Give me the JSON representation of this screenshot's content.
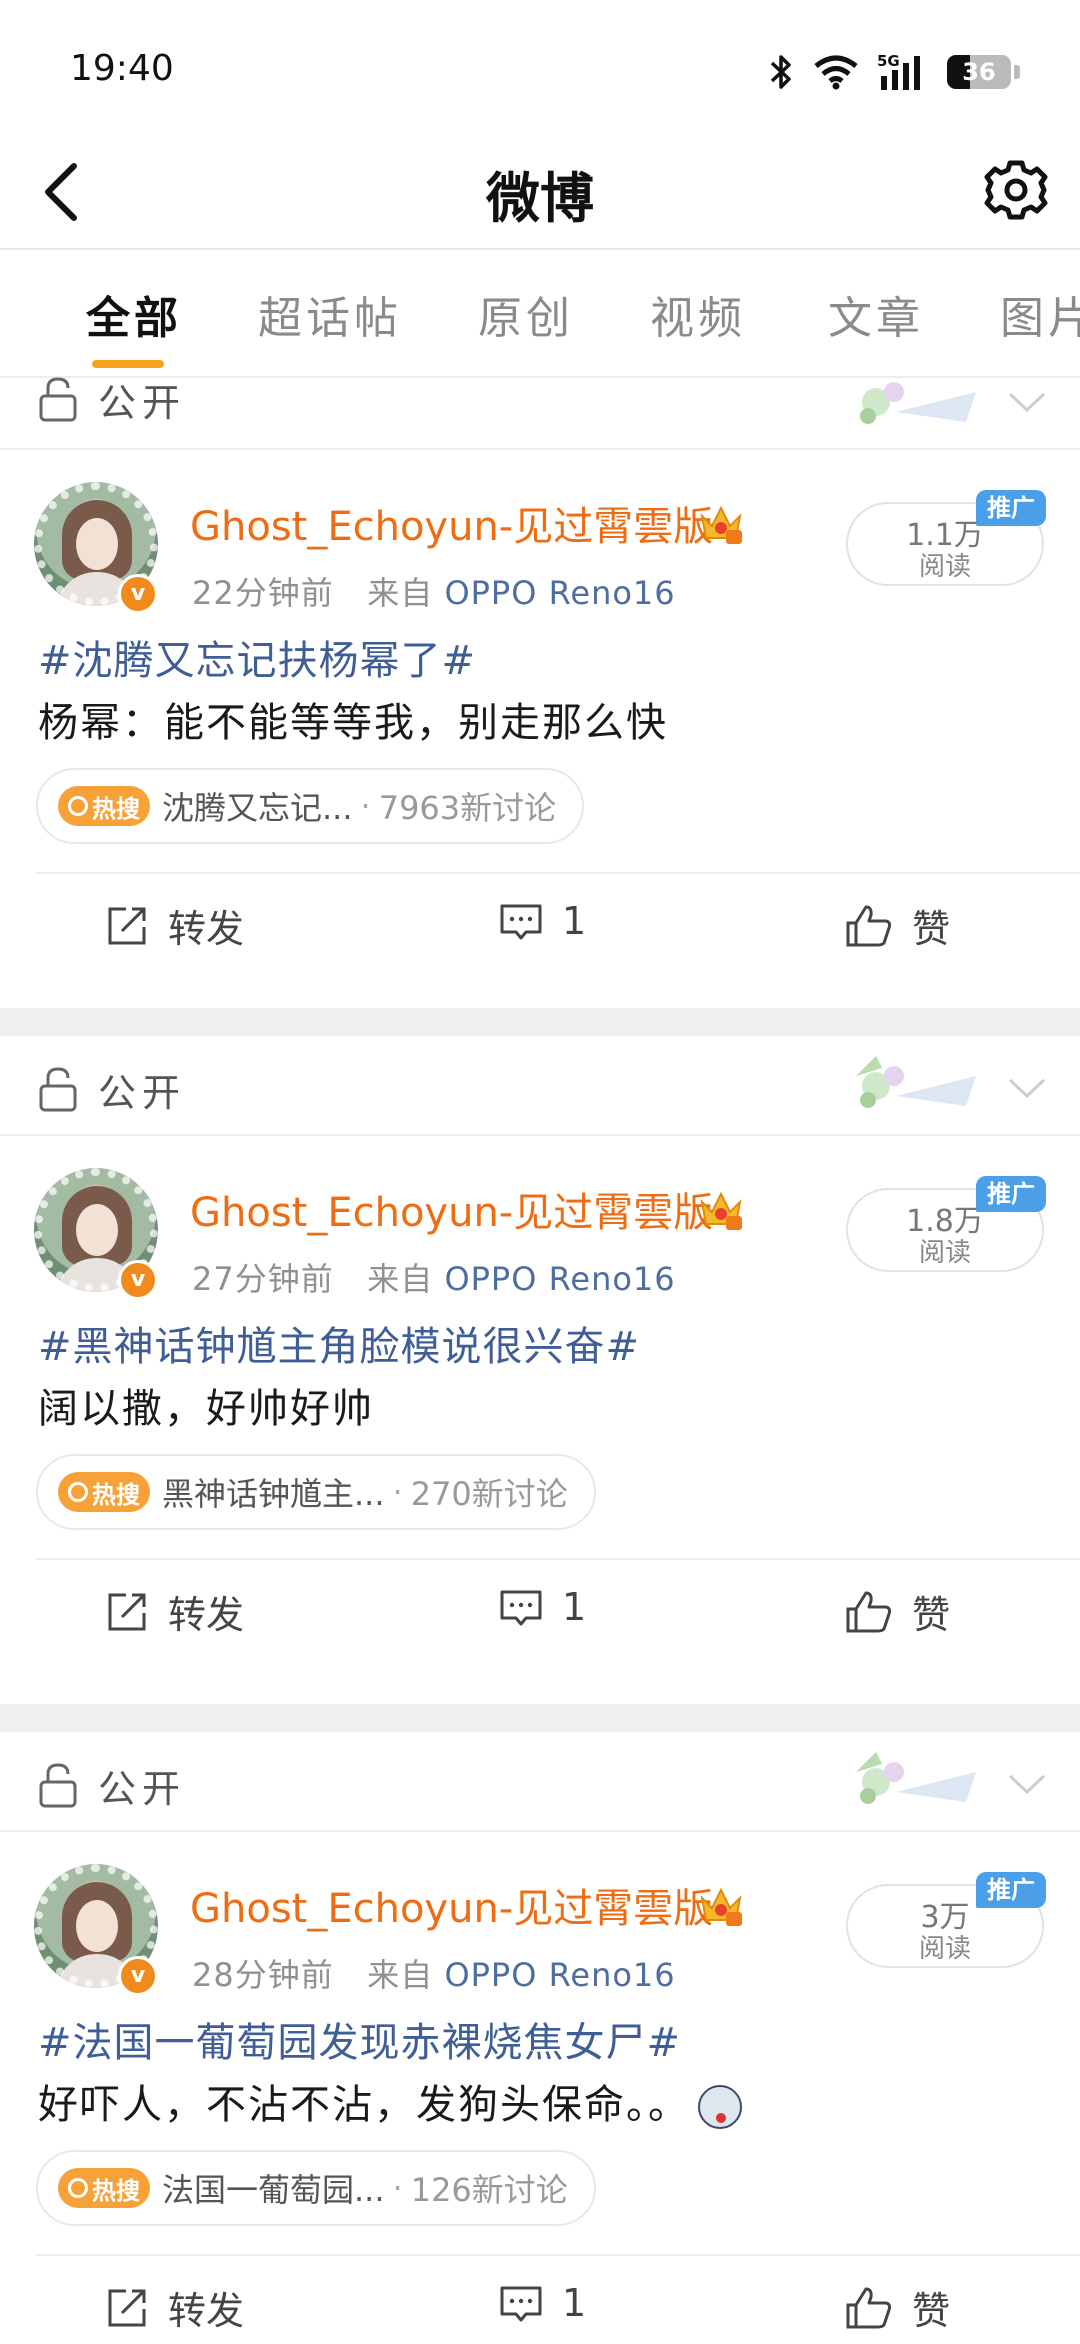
{
  "status_bar": {
    "time": "19:40",
    "battery": "36",
    "network": "5G"
  },
  "header": {
    "title": "微博"
  },
  "tabs": [
    {
      "label": "全部",
      "active": true
    },
    {
      "label": "超话帖",
      "active": false
    },
    {
      "label": "原创",
      "active": false
    },
    {
      "label": "视频",
      "active": false
    },
    {
      "label": "文章",
      "active": false
    },
    {
      "label": "图片",
      "active": false
    }
  ],
  "privacy_label": "公开",
  "posts": [
    {
      "username": "Ghost_Echoyun-见过霄雲版",
      "time": "22分钟前",
      "from_label": "来自",
      "source": "OPPO Reno16",
      "reads_num": "1.1万",
      "reads_label": "阅读",
      "promo": "推广",
      "topic": "#沈腾又忘记扶杨幂了#",
      "text": "杨幂：能不能等等我，别走那么快",
      "hot_tag": "热搜",
      "hot_text": "沈腾又忘记...",
      "hot_count": "7963新讨论",
      "repost": "转发",
      "comments": "1",
      "like": "赞"
    },
    {
      "username": "Ghost_Echoyun-见过霄雲版",
      "time": "27分钟前",
      "from_label": "来自",
      "source": "OPPO Reno16",
      "reads_num": "1.8万",
      "reads_label": "阅读",
      "promo": "推广",
      "topic": "#黑神话钟馗主角脸模说很兴奋#",
      "text": "阔以撒，好帅好帅",
      "hot_tag": "热搜",
      "hot_text": "黑神话钟馗主...",
      "hot_count": "270新讨论",
      "repost": "转发",
      "comments": "1",
      "like": "赞"
    },
    {
      "username": "Ghost_Echoyun-见过霄雲版",
      "time": "28分钟前",
      "from_label": "来自",
      "source": "OPPO Reno16",
      "reads_num": "3万",
      "reads_label": "阅读",
      "promo": "推广",
      "topic": "#法国一葡萄园发现赤裸烧焦女尸#",
      "text": "好吓人，不沾不沾，发狗头保命。。",
      "hot_tag": "热搜",
      "hot_text": "法国一葡萄园...",
      "hot_count": "126新讨论",
      "repost": "转发",
      "comments": "1",
      "like": "赞"
    }
  ],
  "colors": {
    "accent": "#f7a21a",
    "username": "#f06c13",
    "topic": "#3f5e96",
    "promo": "#4a9fe8"
  }
}
